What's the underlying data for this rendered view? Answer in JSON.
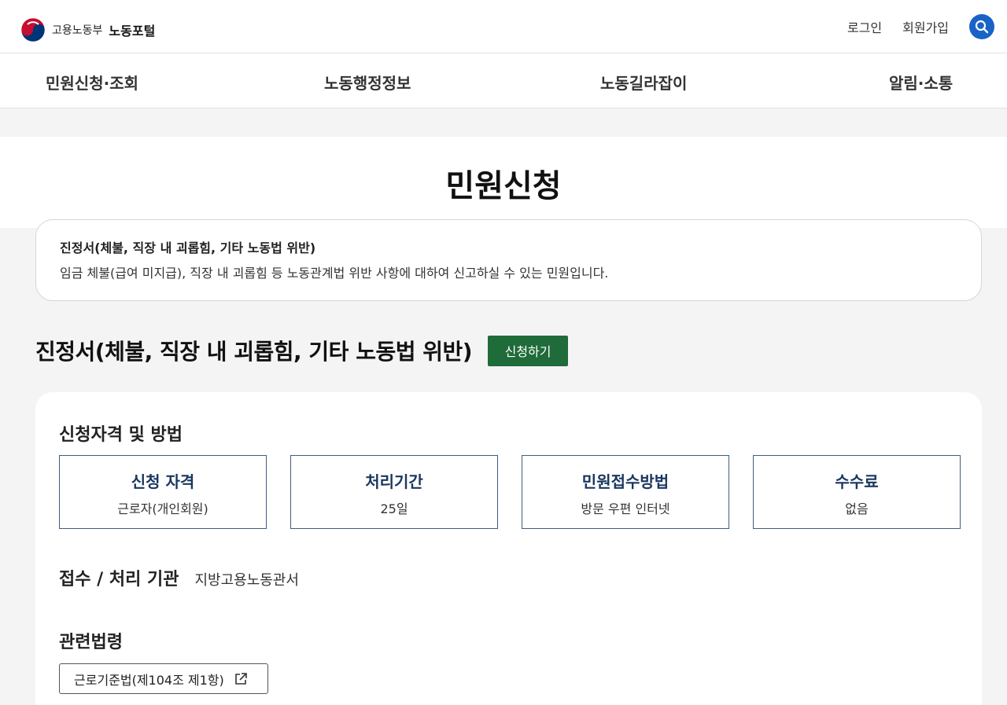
{
  "header": {
    "ministry": "고용노동부",
    "portal": "노동포털",
    "login": "로그인",
    "signup": "회원가입",
    "search_icon": "search-icon"
  },
  "nav": {
    "items": [
      {
        "label": "민원신청·조회"
      },
      {
        "label": "노동행정정보"
      },
      {
        "label": "노동길라잡이"
      },
      {
        "label": "알림·소통"
      }
    ]
  },
  "page": {
    "title": "민원신청"
  },
  "intro": {
    "title": "진정서(체불, 직장 내 괴롭힘, 기타 노동법 위반)",
    "description": "임금 체불(급여 미지급), 직장 내 괴롭힘 등 노동관계법 위반 사항에 대하여 신고하실 수 있는 민원입니다."
  },
  "service": {
    "title": "진정서(체불, 직장 내 괴롭힘, 기타 노동법 위반)",
    "apply_label": "신청하기"
  },
  "details": {
    "section_title": "신청자격 및 방법",
    "boxes": [
      {
        "key": "신청 자격",
        "value": "근로자(개인회원)"
      },
      {
        "key": "처리기간",
        "value": "25일"
      },
      {
        "key": "민원접수방법",
        "value": "방문 우편 인터넷"
      },
      {
        "key": "수수료",
        "value": "없음"
      }
    ],
    "agency_label": "접수 / 처리 기관",
    "agency_value": "지방고용노동관서",
    "law_title": "관련법령",
    "law_link": "근로기준법(제104조 제1항)",
    "law_link_icon": "external-link-icon"
  },
  "colors": {
    "accent_blue": "#1a63c6",
    "apply_green": "#1f6b39",
    "box_border": "#3e5f7e",
    "box_key": "#1b3760"
  }
}
